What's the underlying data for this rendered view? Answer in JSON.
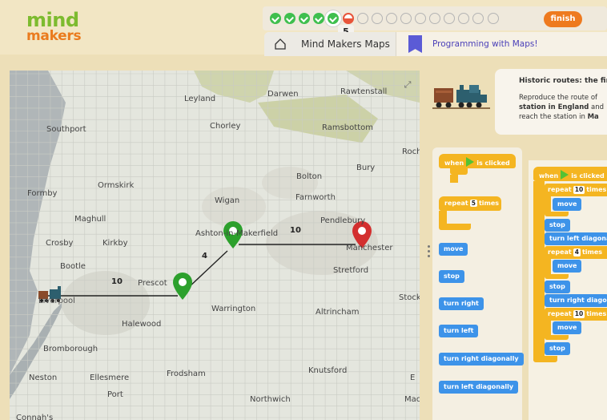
{
  "logo": {
    "line1": "mind",
    "line2": "makers"
  },
  "progress": {
    "completed_steps": 5,
    "total_steps": 16,
    "current_step": 5,
    "current_label": "5",
    "finish_label": "finish"
  },
  "tabs": [
    {
      "label": "Mind Makers Maps",
      "icon": "home-icon"
    },
    {
      "label": "Programming with Maps!",
      "icon": "bookmark-icon"
    }
  ],
  "map": {
    "toggle_icon": "expand-icon",
    "places": [
      "Leyland",
      "Darwen",
      "Rawtenstall",
      "Southport",
      "Chorley",
      "Ramsbottom",
      "Roch",
      "Bury",
      "Bolton",
      "Formby",
      "Ormskirk",
      "Wigan",
      "Farnworth",
      "Maghull",
      "Pendlebury",
      "Crosby",
      "Kirkby",
      "Ashton-in-Makerfield",
      "Manchester",
      "Bootle",
      "Prescot",
      "Stretford",
      "Stock",
      "Liverpool",
      "Warrington",
      "Altrincham",
      "Halewood",
      "Bromborough",
      "Knutsford",
      "Neston",
      "Ellesmere",
      "Port",
      "Frodsham",
      "Northwich",
      "Mac",
      "Connah's",
      "E"
    ],
    "segments": [
      "10",
      "4",
      "10"
    ],
    "colors": {
      "start_marker": "#2ca02c",
      "finish_marker": "#d32f2f"
    }
  },
  "instructions": {
    "title": "Historic routes: the firs",
    "line1_a": "Reproduce the route of",
    "line2_b": "station in England",
    "line2_a": " and",
    "line3_a": "reach the station in ",
    "line3_b": "Ma"
  },
  "palette": {
    "when_label": "when",
    "clicked_label": "is clicked",
    "repeat_label": "repeat",
    "repeat_count": "5",
    "times_label": "times",
    "blocks": [
      "move",
      "stop",
      "turn right",
      "turn left",
      "turn right diagonally",
      "turn left diagonally"
    ]
  },
  "script": {
    "when_label": "when",
    "clicked_label": "is clicked",
    "rows": [
      {
        "text": "repeat",
        "num": "10",
        "tail": "times"
      },
      {
        "text": "move"
      },
      {
        "text": "stop"
      },
      {
        "text": "turn left diagonally"
      },
      {
        "text": "repeat",
        "num": "4",
        "tail": "times"
      },
      {
        "text": "move"
      },
      {
        "text": "stop"
      },
      {
        "text": "turn right diagonally"
      },
      {
        "text": "repeat",
        "num": "10",
        "tail": "times"
      },
      {
        "text": "move"
      },
      {
        "text": "stop"
      }
    ]
  }
}
